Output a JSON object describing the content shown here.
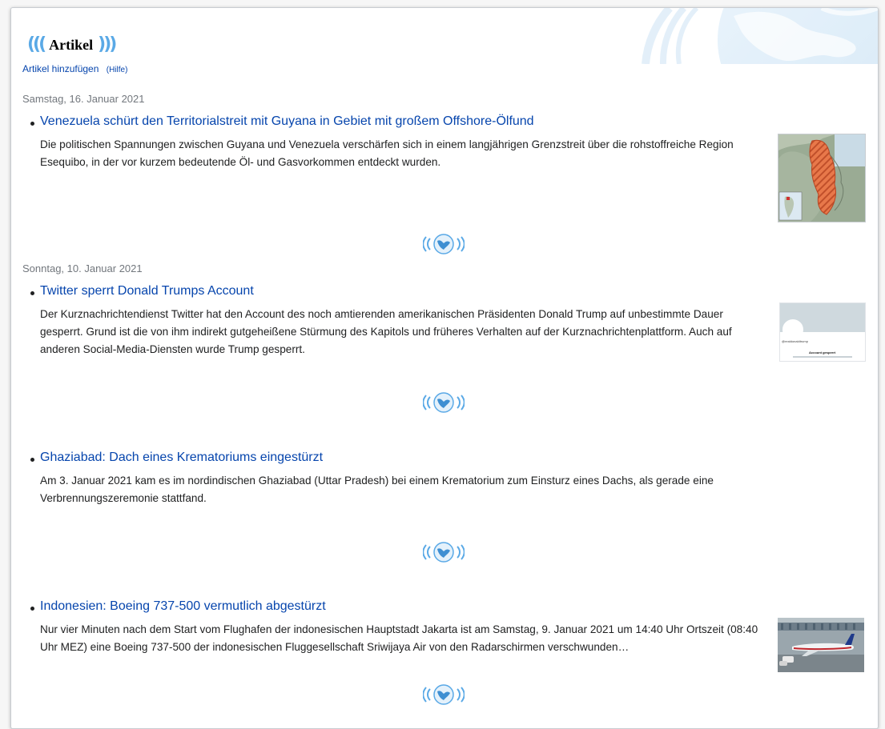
{
  "header": {
    "title": "Artikel"
  },
  "actions": {
    "add_label": "Artikel hinzufügen",
    "help_label": "(Hilfe)"
  },
  "dates": [
    "Samstag, 16. Januar 2021",
    "Sonntag, 10. Januar 2021"
  ],
  "articles": [
    {
      "title": "Venezuela schürt den Territorialstreit mit Guyana in Gebiet mit großem Offshore-Ölfund",
      "summary": "Die politischen Spannungen zwischen Guyana und Venezuela verschärfen sich in einem langjährigen Grenzstreit über die rohstoffreiche Region Esequibo, in der vor kurzem bedeutende Öl- und Gasvorkommen entdeckt wurden.",
      "image": "map-esequibo"
    },
    {
      "title": "Twitter sperrt Donald Trumps Account",
      "summary": "Der Kurznachrichtendienst Twitter hat den Account des noch amtierenden amerikanischen Präsidenten Donald Trump auf unbestimmte Dauer gesperrt. Grund ist die von ihm indirekt gutgeheißene Stürmung des Kapitols und früheres Verhalten auf der Kurznachrichtenplattform. Auch auf anderen Social-Media-Diensten wurde Trump gesperrt.",
      "image": "twitter-suspended-screenshot",
      "thumb_texts": [
        "@realdonaldtrump",
        "Account gesperrt"
      ]
    },
    {
      "title": "Ghaziabad: Dach eines Krematoriums eingestürzt",
      "summary": "Am 3. Januar 2021 kam es im nordindischen Ghaziabad (Uttar Pradesh) bei einem Krematorium zum Einsturz eines Dachs, als gerade eine Verbrennungszeremonie stattfand."
    },
    {
      "title": "Indonesien: Boeing 737-500 vermutlich abgestürzt",
      "summary": "Nur vier Minuten nach dem Start vom Flughafen der indonesischen Hauptstadt Jakarta ist am Samstag, 9. Januar 2021 um 14:40 Uhr Ortszeit (08:40 Uhr MEZ) eine Boeing 737-500 der indonesischen Fluggesellschaft Sriwijaya Air von den Radarschirmen verschwunden…",
      "image": "airplane-photo"
    }
  ],
  "colors": {
    "link": "#0645ad",
    "accent": "#5aa9e6",
    "date": "#72777d"
  }
}
